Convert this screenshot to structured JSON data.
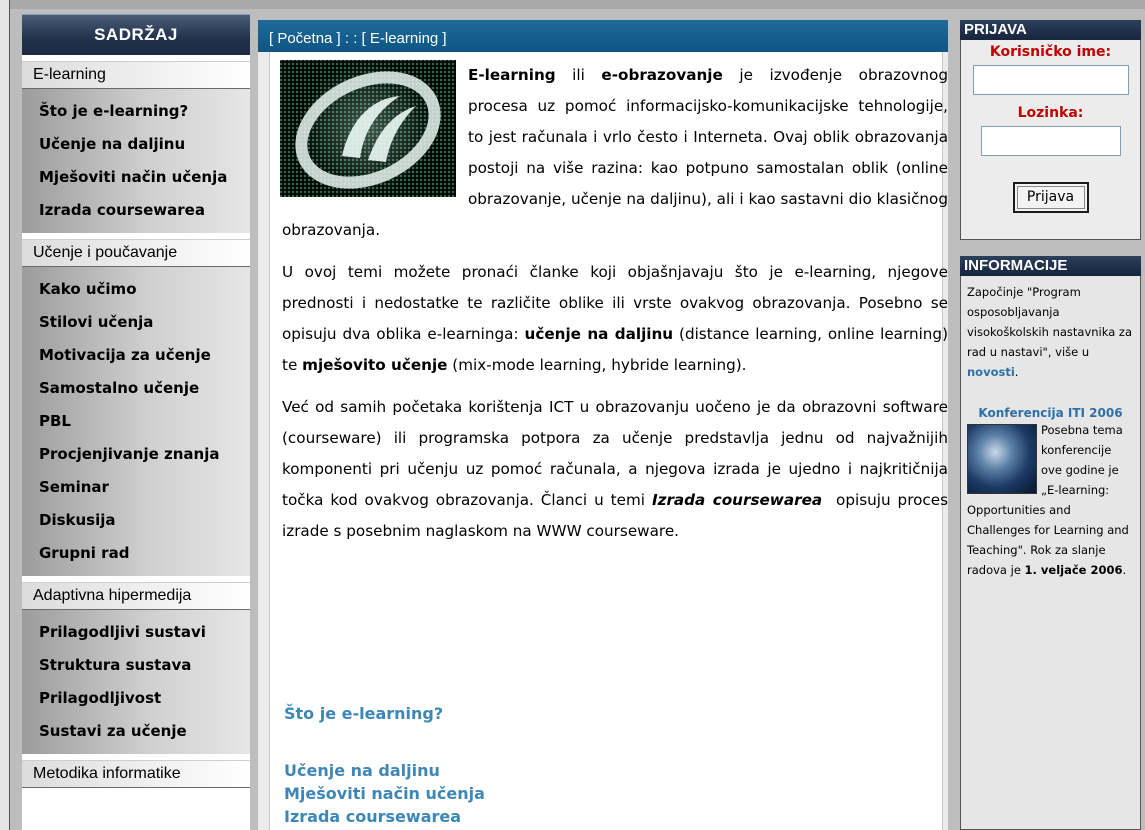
{
  "sidebar": {
    "title": "SADRŽAJ",
    "sections": [
      {
        "label": "E-learning",
        "items": [
          "Što je e-learning?",
          "Učenje na daljinu",
          "Mješoviti način učenja",
          "Izrada coursewarea"
        ]
      },
      {
        "label": "Učenje i poučavanje",
        "items": [
          "Kako učimo",
          "Stilovi učenja",
          "Motivacija za učenje",
          "Samostalno učenje",
          "PBL",
          "Procjenjivanje znanja",
          "Seminar",
          "Diskusija",
          "Grupni rad"
        ]
      },
      {
        "label": "Adaptivna hipermedija",
        "items": [
          "Prilagodljivi sustavi",
          "Struktura sustava",
          "Prilagodljivost",
          "Sustavi za učenje"
        ]
      },
      {
        "label": "Metodika informatike",
        "items": []
      }
    ]
  },
  "breadcrumb": "[ Početna ] : : [ E-learning ]",
  "article": {
    "p1": {
      "b1": "E-learning",
      "t1": " ili ",
      "b2": "e-obrazovanje",
      "t2": " je izvođenje obrazovnog procesa uz pomoć informacijsko-komunikacijske tehnologije, to jest računala i vrlo često i Interneta. Ovaj oblik obrazovanja postoji na više razina: kao potpuno samostalan oblik (online obrazovanje, učenje na daljinu), ali i kao sastavni dio klasičnog obrazovanja."
    },
    "p2": {
      "t1": "U ovoj temi možete pronaći članke koji objašnjavaju što je e-learning, njegove prednosti i nedostatke te različite oblike ili vrste ovakvog obrazovanja. Posebno se opisuju dva oblika e-learninga: ",
      "b1": "učenje na daljinu",
      "t2": " (distance learning, online learning) te ",
      "b2": "mješovito učenje",
      "t3": " (mix-mode learning, hybride learning)."
    },
    "p3": {
      "t1": "Već od samih početaka korištenja ICT u obrazovanju uočeno je da obrazovni software (courseware) ili programska potpora za učenje predstavlja jednu od najvažnijih komponenti pri učenju uz pomoć računala, a njegova izrada je ujedno i najkritičnija točka kod ovakvog obrazovanja. Članci u temi ",
      "bi": "Izrada coursewarea",
      "t2": "  opisuju proces izrade s posebnim naglaskom na WWW courseware."
    },
    "links": [
      "Što je e-learning?",
      "Učenje na daljinu",
      "Mješoviti način učenja",
      "Izrada coursewarea"
    ]
  },
  "login": {
    "title": "PRIJAVA",
    "username_label": "Korisničko ime:",
    "password_label": "Lozinka:",
    "button": "Prijava",
    "username_value": "",
    "password_value": ""
  },
  "info": {
    "title": "INFORMACIJE",
    "text1": "Započinje \"Program osposobljavanja visokoškolskih nastavnika za rad u nastavi\", više u ",
    "news_link": "novosti",
    "text1_end": ".",
    "conf_title": "Konferencija ITI 2006",
    "conf_text": "Posebna tema konferencije ove godine je „E-learning: Opportunities and Challenges for Learning and Teaching\". Rok za slanje radova je ",
    "conf_bold1": "1. veljače 2006",
    "conf_end": "."
  },
  "colors": {
    "breadcrumb_bg": "#0d5685",
    "link": "#3d87b6",
    "login_label": "#c00000",
    "sidebar_header": "#24344e"
  }
}
